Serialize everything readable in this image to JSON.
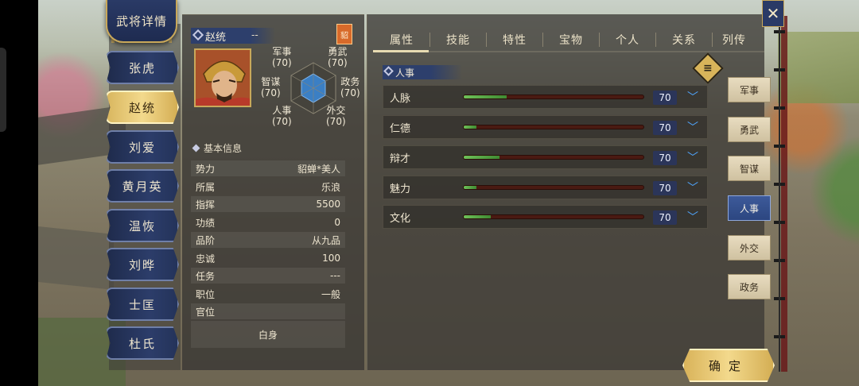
{
  "title": "武将详情",
  "generals": [
    {
      "name": "张虎",
      "active": false
    },
    {
      "name": "赵统",
      "active": true
    },
    {
      "name": "刘爱",
      "active": false
    },
    {
      "name": "黄月英",
      "active": false
    },
    {
      "name": "温恢",
      "active": false
    },
    {
      "name": "刘晔",
      "active": false
    },
    {
      "name": "士匡",
      "active": false
    },
    {
      "name": "杜氏",
      "active": false
    }
  ],
  "profile": {
    "name": "赵统",
    "dash": "--",
    "seal": "貂"
  },
  "hex_stats": {
    "military": {
      "label": "军事",
      "value": "(70)"
    },
    "bravery": {
      "label": "勇武",
      "value": "(70)"
    },
    "strategy": {
      "label": "智谋",
      "value": "(70)"
    },
    "politics": {
      "label": "政务",
      "value": "(70)"
    },
    "personnel": {
      "label": "人事",
      "value": "(70)"
    },
    "diplomacy": {
      "label": "外交",
      "value": "(70)"
    }
  },
  "basic_info": {
    "section_title": "基本信息",
    "rows": [
      {
        "label": "势力",
        "value": "貂蝉*美人"
      },
      {
        "label": "所属",
        "value": "乐浪"
      },
      {
        "label": "指挥",
        "value": "5500"
      },
      {
        "label": "功绩",
        "value": "0"
      },
      {
        "label": "品阶",
        "value": "从九品"
      },
      {
        "label": "忠诚",
        "value": "100"
      },
      {
        "label": "任务",
        "value": "---"
      },
      {
        "label": "职位",
        "value": "一般"
      },
      {
        "label": "官位",
        "value": ""
      }
    ],
    "rank_title": "白身"
  },
  "tabs": [
    "属性",
    "技能",
    "特性",
    "宝物",
    "个人",
    "关系",
    "列传"
  ],
  "active_tab": "属性",
  "attr_section": "人事",
  "attributes": [
    {
      "name": "人脉",
      "value": "70",
      "fill": 0.24
    },
    {
      "name": "仁德",
      "value": "70",
      "fill": 0.07
    },
    {
      "name": "辩才",
      "value": "70",
      "fill": 0.2
    },
    {
      "name": "魅力",
      "value": "70",
      "fill": 0.07
    },
    {
      "name": "文化",
      "value": "70",
      "fill": 0.15
    }
  ],
  "side_tabs": [
    {
      "label": "军事",
      "active": false
    },
    {
      "label": "勇武",
      "active": false
    },
    {
      "label": "智谋",
      "active": false
    },
    {
      "label": "人事",
      "active": true
    },
    {
      "label": "外交",
      "active": false
    },
    {
      "label": "政务",
      "active": false
    }
  ],
  "confirm_label": "确定",
  "icons": {
    "close": "close-icon",
    "menu": "list-menu-icon",
    "chevron": "chevron-down-icon"
  },
  "colors": {
    "accent_gold": "#d9b35a",
    "navy": "#2c3d6a",
    "bar_fill": "#5fb04c",
    "bar_track": "#4a1a12",
    "value_box": "#2b3559"
  }
}
